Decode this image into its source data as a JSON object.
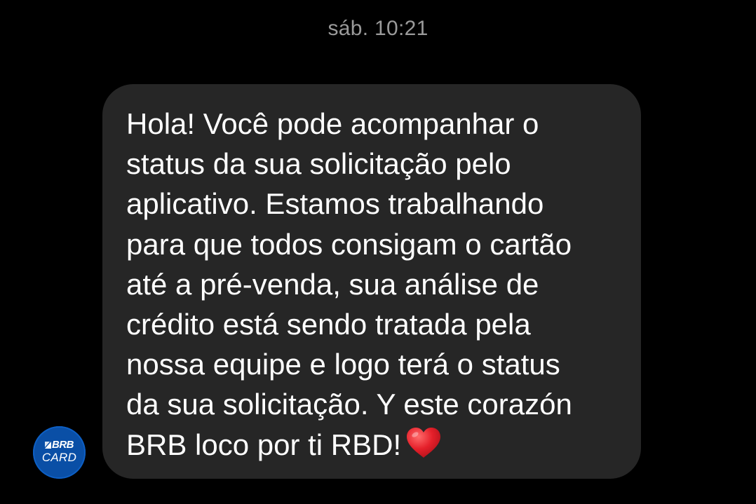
{
  "conversation": {
    "timestamp": "sáb. 10:21"
  },
  "message": {
    "text_lines": [
      "Hola! Você pode acompanhar o",
      "status da sua solicitação pelo",
      "aplicativo. Estamos trabalhando",
      "para que todos consigam o cartão",
      "até a pré-venda, sua análise de",
      "crédito está sendo tratada pela",
      "nossa equipe e logo terá o status",
      "da sua solicitação. Y este corazón",
      "BRB loco por ti RBD!"
    ],
    "emoji": "heart-emoji",
    "bubble_color": "#262626",
    "text_color": "#ffffff"
  },
  "sender": {
    "logo_top": "BRB",
    "logo_bottom": "CARD",
    "avatar_color": "#0a4fa6"
  },
  "theme": {
    "background": "#000000",
    "timestamp_color": "#9a9a9a"
  }
}
